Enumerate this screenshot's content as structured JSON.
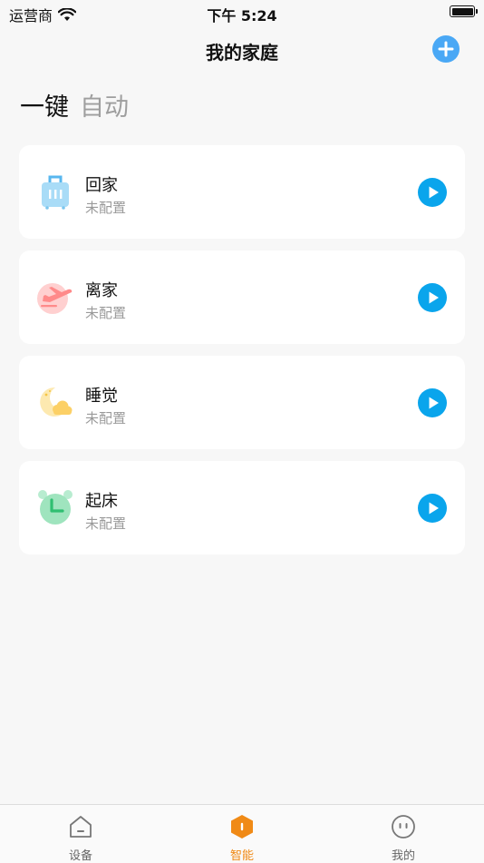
{
  "status_bar": {
    "carrier": "运营商",
    "time": "下午 5:24"
  },
  "header": {
    "title": "我的家庭"
  },
  "mode_tabs": [
    {
      "label": "一键",
      "active": true
    },
    {
      "label": "自动",
      "active": false
    }
  ],
  "scenes": [
    {
      "name": "回家",
      "status": "未配置",
      "icon": "luggage-icon"
    },
    {
      "name": "离家",
      "status": "未配置",
      "icon": "airplane-icon"
    },
    {
      "name": "睡觉",
      "status": "未配置",
      "icon": "moon-cloud-icon"
    },
    {
      "name": "起床",
      "status": "未配置",
      "icon": "alarm-clock-icon"
    }
  ],
  "tab_bar": [
    {
      "label": "设备",
      "icon": "home-icon",
      "active": false
    },
    {
      "label": "智能",
      "icon": "hexagon-smart-icon",
      "active": true
    },
    {
      "label": "我的",
      "icon": "face-icon",
      "active": false
    }
  ],
  "colors": {
    "accent": "#0aa5ec",
    "add_button": "#4aa8f5",
    "tab_active": "#f08a16"
  }
}
